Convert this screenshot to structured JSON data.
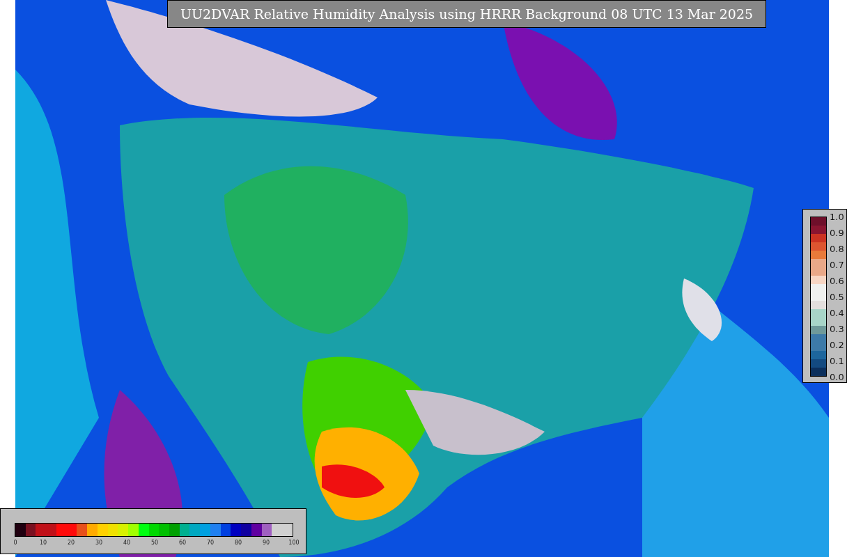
{
  "title": "UU2DVAR Relative Humidity Analysis using HRRR Background 08 UTC 13 Mar 2025",
  "colorbars": [
    {
      "kind": "horizontal",
      "ticks": [
        "0",
        "10",
        "20",
        "30",
        "40",
        "50",
        "60",
        "70",
        "80",
        "90",
        "100"
      ],
      "segments": [
        {
          "color": "#200010"
        },
        {
          "color": "#7a1020"
        },
        {
          "color": "#c01018"
        },
        {
          "color": "#c01018"
        },
        {
          "color": "#ff0a0a"
        },
        {
          "color": "#ff0a0a"
        },
        {
          "color": "#e8501a"
        },
        {
          "color": "#ffaa00"
        },
        {
          "color": "#ffd000"
        },
        {
          "color": "#f0e000"
        },
        {
          "color": "#d8f000"
        },
        {
          "color": "#a0ff00"
        },
        {
          "color": "#00ff10"
        },
        {
          "color": "#00d800"
        },
        {
          "color": "#00c000"
        },
        {
          "color": "#00a000"
        },
        {
          "color": "#00b090"
        },
        {
          "color": "#00a8c0"
        },
        {
          "color": "#00a0e0"
        },
        {
          "color": "#2080f0"
        },
        {
          "color": "#0040e0"
        },
        {
          "color": "#0000c0"
        },
        {
          "color": "#1000a0"
        },
        {
          "color": "#6000a0"
        },
        {
          "color": "#a060c0"
        },
        {
          "color": "#d0d0d0"
        },
        {
          "color": "#d0d0d0"
        }
      ]
    },
    {
      "kind": "vertical",
      "ticks": [
        "1.0",
        "0.9",
        "0.8",
        "0.7",
        "0.6",
        "0.5",
        "0.4",
        "0.3",
        "0.2",
        "0.1",
        "0.0"
      ],
      "segments": [
        {
          "color": "#6e0f2a"
        },
        {
          "color": "#8a1530"
        },
        {
          "color": "#cc3322"
        },
        {
          "color": "#dd5530"
        },
        {
          "color": "#e87a3a"
        },
        {
          "color": "#e9a888"
        },
        {
          "color": "#e9a888"
        },
        {
          "color": "#f7d6c4"
        },
        {
          "color": "#f0f1ef"
        },
        {
          "color": "#f0f1ef"
        },
        {
          "color": "#e3dfdd"
        },
        {
          "color": "#a8d5c8"
        },
        {
          "color": "#a8d5c8"
        },
        {
          "color": "#6f9a9a"
        },
        {
          "color": "#3d7aa8"
        },
        {
          "color": "#3d7aa8"
        },
        {
          "color": "#1d669d"
        },
        {
          "color": "#134a80"
        },
        {
          "color": "#0b2f5c"
        }
      ]
    }
  ]
}
